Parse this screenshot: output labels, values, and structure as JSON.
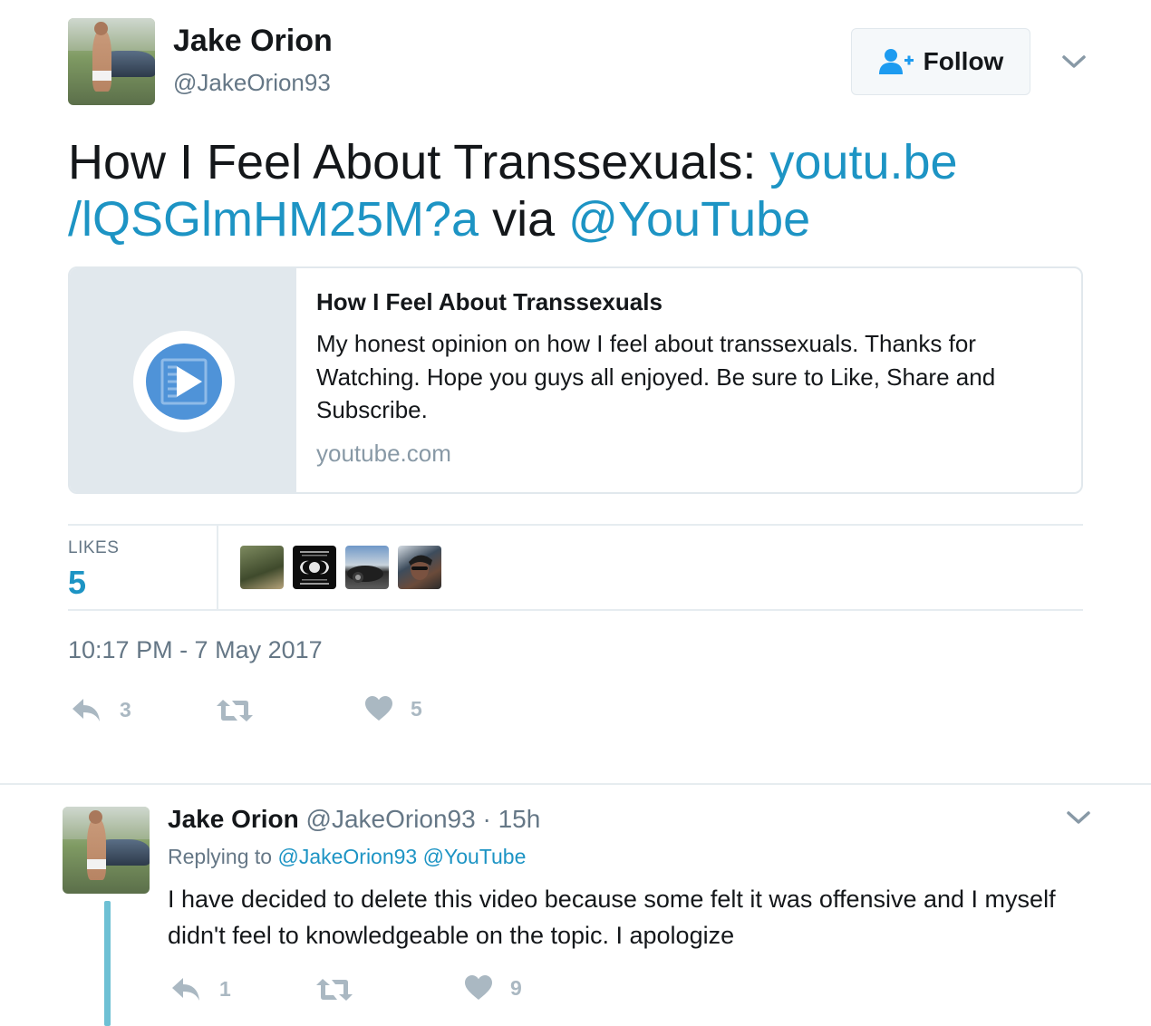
{
  "main_tweet": {
    "author_name": "Jake Orion",
    "author_handle": "@JakeOrion93",
    "follow_label": "Follow",
    "text_plain_1": "How I Feel About Transsexuals: ",
    "text_link_1": "youtu.be",
    "text_link_2": "/lQSGlmHM25M?a",
    "text_plain_2": " via ",
    "text_mention": "@YouTube",
    "card": {
      "title": "How I Feel About Transsexuals",
      "description": "My honest opinion on how I feel about transsexuals. Thanks for Watching. Hope you guys all enjoyed. Be sure to Like, Share and Subscribe.",
      "domain": "youtube.com"
    },
    "likes_label": "LIKES",
    "likes_count": "5",
    "timestamp": "10:17 PM - 7 May 2017",
    "reply_count": "3",
    "retweet_count": "",
    "like_count": "5"
  },
  "reply_tweet": {
    "author_name": "Jake Orion",
    "author_handle": "@JakeOrion93",
    "separator": " · ",
    "time": "15h",
    "replying_prefix": "Replying to ",
    "replying_to_1": "@JakeOrion93",
    "replying_to_2": "@YouTube",
    "text": "I have decided to delete this video because some felt it was offensive and I myself didn't feel to knowledgeable on the topic. I apologize",
    "reply_count": "1",
    "retweet_count": "",
    "like_count": "9"
  },
  "colors": {
    "link": "#1d94c4",
    "muted": "#657786",
    "action_icon": "#aab8c2",
    "thread_line": "#6ec0d4"
  },
  "icons": [
    "follow-person-plus-icon",
    "chevron-down-icon",
    "video-play-icon",
    "reply-icon",
    "retweet-icon",
    "heart-icon"
  ]
}
